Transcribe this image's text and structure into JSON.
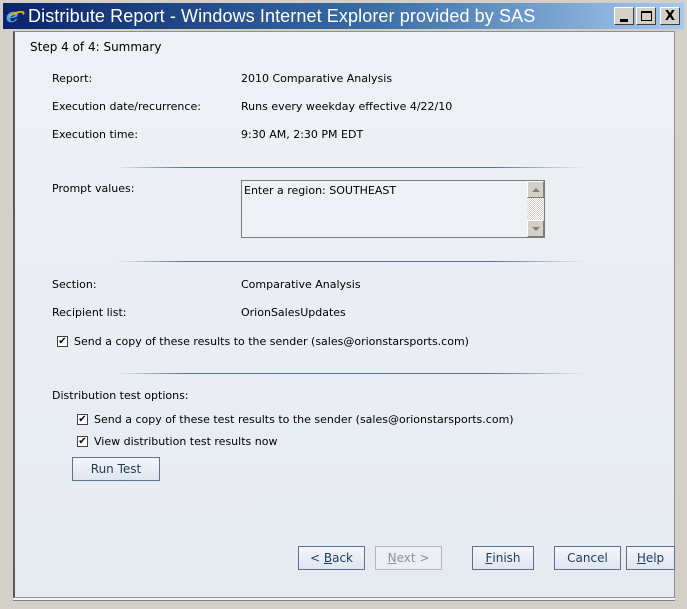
{
  "window": {
    "title": "Distribute Report - Windows Internet Explorer provided by SAS",
    "controls": {
      "minimize": "minimize",
      "maximize": "maximize",
      "close": "X"
    }
  },
  "wizard": {
    "step_title": "Step 4 of 4: Summary",
    "summary": [
      {
        "label": "Report:",
        "value": "2010 Comparative Analysis"
      },
      {
        "label": "Execution date/recurrence:",
        "value": "Runs every weekday effective 4/22/10"
      },
      {
        "label": "Execution time:",
        "value": "9:30 AM, 2:30 PM EDT"
      }
    ],
    "prompt_values": {
      "label": "Prompt values:",
      "text": "Enter a region: SOUTHEAST"
    },
    "details": [
      {
        "label": "Section:",
        "value": "Comparative Analysis"
      },
      {
        "label": "Recipient list:",
        "value": "OrionSalesUpdates"
      }
    ],
    "send_copy": {
      "label": "Send a copy of these results to the sender (sales@orionstarsports.com)",
      "checked": true
    },
    "test_options": {
      "heading": "Distribution test options:",
      "send_test_copy": {
        "label": "Send a copy of these test results to the sender (sales@orionstarsports.com)",
        "checked": true
      },
      "view_now": {
        "label": "View distribution test results now",
        "checked": true
      },
      "run_test_label": "Run Test"
    },
    "buttons": {
      "back": {
        "prefix": "< ",
        "accel": "B",
        "rest": "ack"
      },
      "next": {
        "accel": "N",
        "rest": "ext >",
        "disabled": true
      },
      "finish": {
        "accel": "F",
        "rest": "inish"
      },
      "cancel": "Cancel",
      "help": {
        "accel": "H",
        "rest": "elp"
      }
    }
  }
}
